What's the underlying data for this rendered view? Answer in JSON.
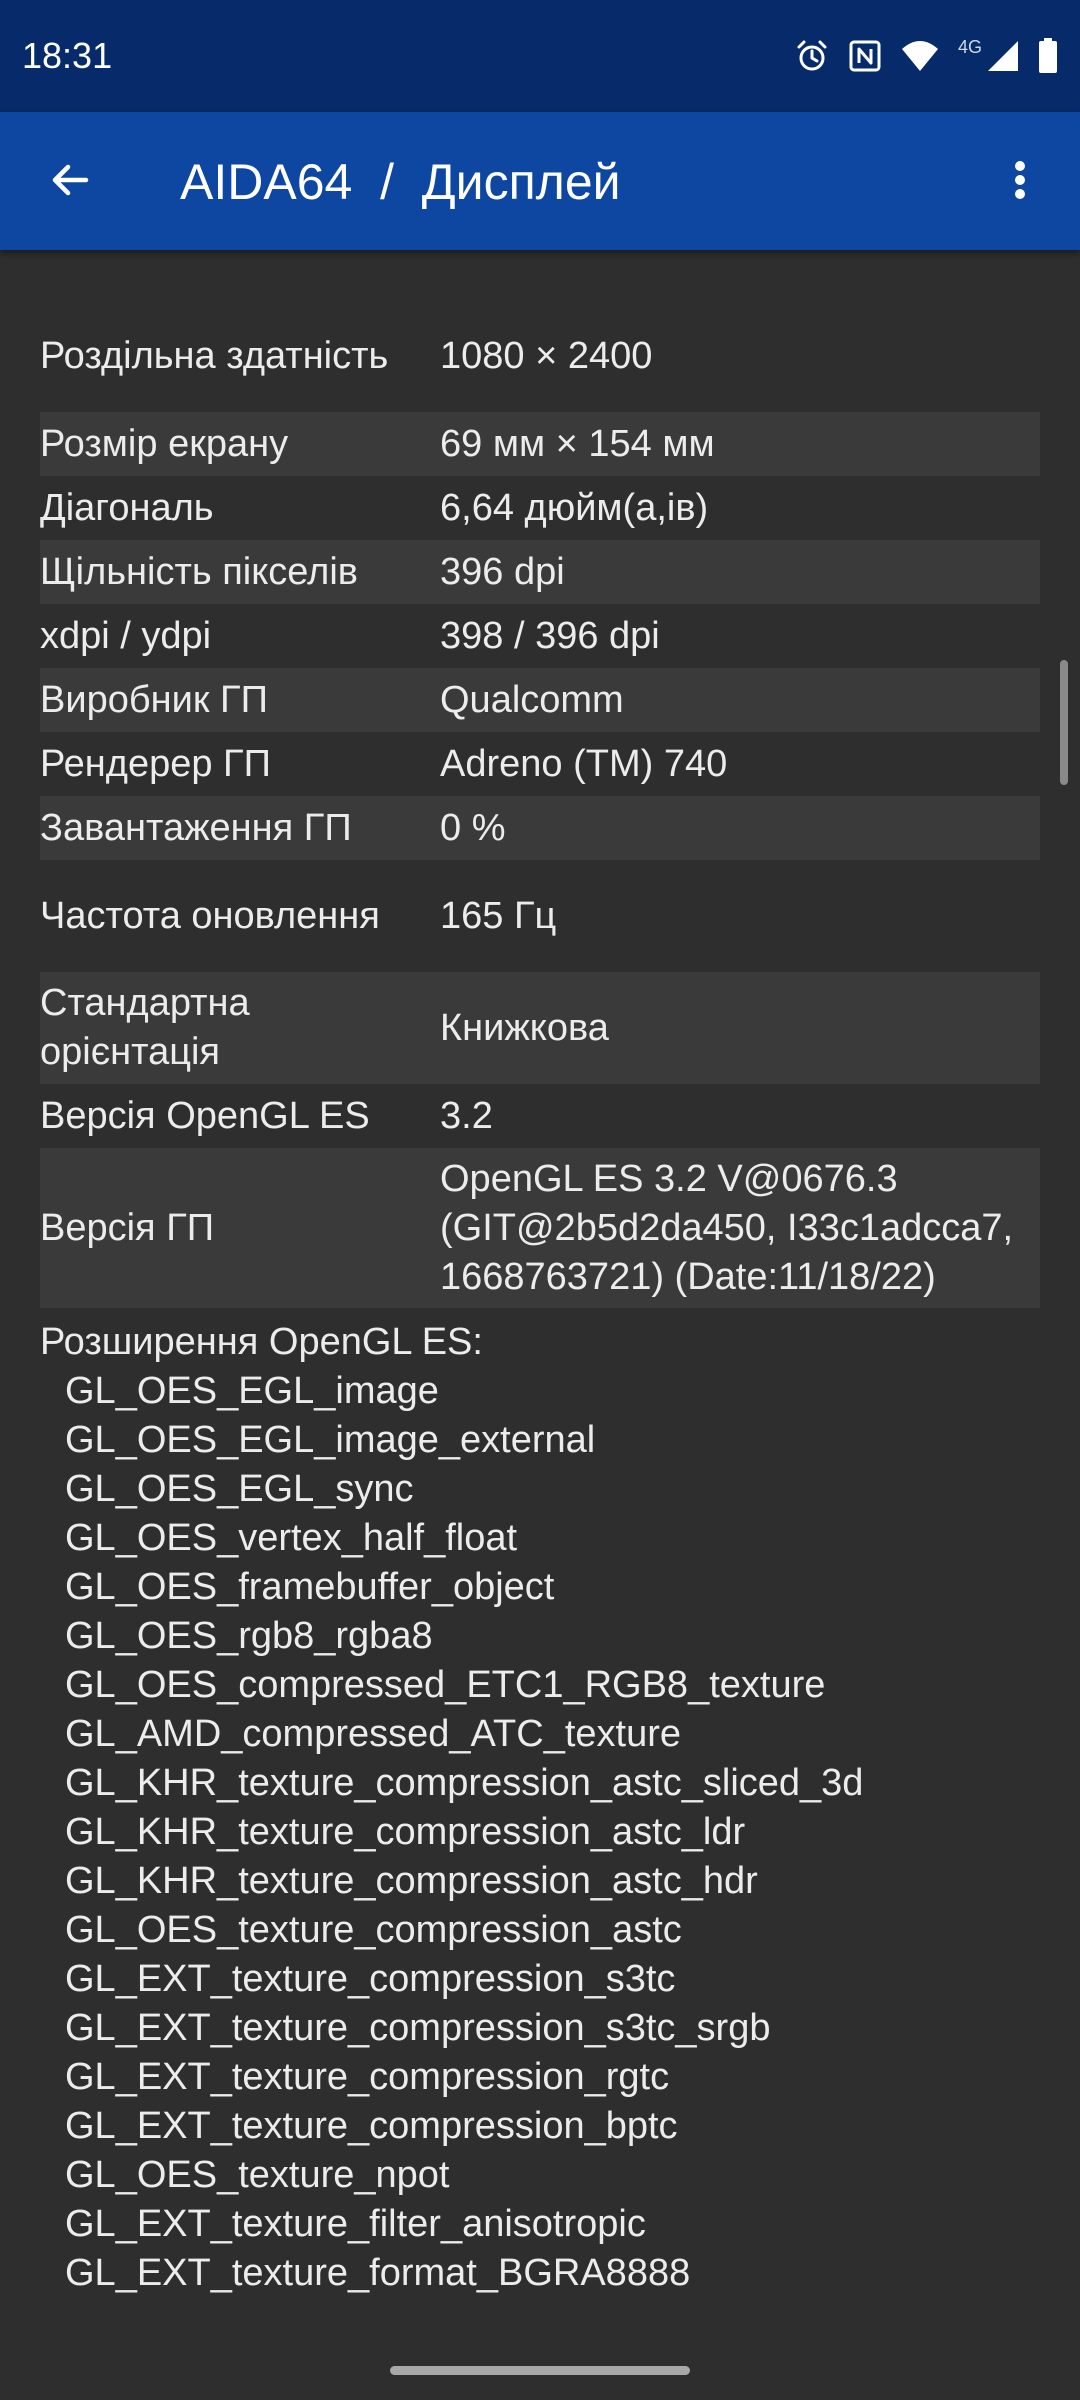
{
  "status_bar": {
    "time": "18:31",
    "network_label": "4G",
    "icons": [
      "alarm-icon",
      "nfc-icon",
      "wifi-icon",
      "signal-icon",
      "battery-icon"
    ]
  },
  "app_bar": {
    "title": "AIDA64  /  Дисплей",
    "back_icon": "arrow-back-icon",
    "menu_icon": "more-vert-icon"
  },
  "rows": [
    {
      "label": "Роздільна здатність",
      "value": "1080 × 2400"
    },
    {
      "label": "Розмір екрану",
      "value": "69 мм × 154 мм"
    },
    {
      "label": "Діагональ",
      "value": "6,64 дюйм(а,ів)"
    },
    {
      "label": "Щільність пікселів",
      "value": "396 dpi"
    },
    {
      "label": "xdpi / ydpi",
      "value": "398 / 396 dpi"
    },
    {
      "label": "Виробник ГП",
      "value": "Qualcomm"
    },
    {
      "label": "Рендерер ГП",
      "value": "Adreno (TM) 740"
    },
    {
      "label": "Завантаження ГП",
      "value": "0 %"
    },
    {
      "label": "Частота оновлення",
      "value": "165 Гц"
    },
    {
      "label": "Стандартна орієнтація",
      "value": "Книжкова"
    },
    {
      "label": "Версія OpenGL ES",
      "value": "3.2"
    },
    {
      "label": "Версія ГП",
      "value": "OpenGL ES 3.2 V@0676.3 (GIT@2b5d2da450, I33c1adcca7, 1668763721) (Date:11/18/22)"
    }
  ],
  "extensions": {
    "title": "Розширення OpenGL ES:",
    "items": [
      "GL_OES_EGL_image",
      "GL_OES_EGL_image_external",
      "GL_OES_EGL_sync",
      "GL_OES_vertex_half_float",
      "GL_OES_framebuffer_object",
      "GL_OES_rgb8_rgba8",
      "GL_OES_compressed_ETC1_RGB8_texture",
      "GL_AMD_compressed_ATC_texture",
      "GL_KHR_texture_compression_astc_sliced_3d",
      "GL_KHR_texture_compression_astc_ldr",
      "GL_KHR_texture_compression_astc_hdr",
      "GL_OES_texture_compression_astc",
      "GL_EXT_texture_compression_s3tc",
      "GL_EXT_texture_compression_s3tc_srgb",
      "GL_EXT_texture_compression_rgtc",
      "GL_EXT_texture_compression_bptc",
      "GL_OES_texture_npot",
      "GL_EXT_texture_filter_anisotropic",
      "GL_EXT_texture_format_BGRA8888"
    ]
  },
  "colors": {
    "status_bar": "#072b6a",
    "app_bar": "#0d47a1",
    "background": "#2e2e2e",
    "alt_row": "#3a3a3a",
    "text": "#ececec"
  }
}
